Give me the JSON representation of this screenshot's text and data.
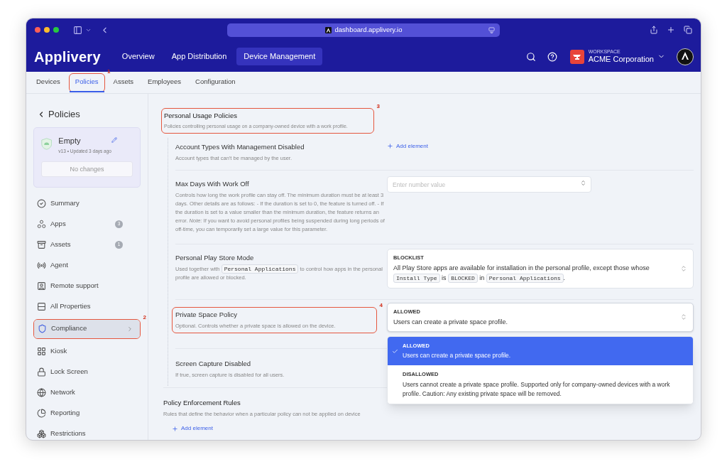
{
  "browser": {
    "url": "dashboard.applivery.io"
  },
  "header": {
    "logo": "Applivery",
    "nav": [
      {
        "label": "Overview",
        "selected": false
      },
      {
        "label": "App Distribution",
        "selected": false
      },
      {
        "label": "Device Management",
        "selected": true
      }
    ],
    "workspace": {
      "caption": "WORKSPACE",
      "name": "ACME Corporation"
    }
  },
  "tabs": [
    {
      "label": "Devices",
      "selected": false
    },
    {
      "label": "Policies",
      "selected": true,
      "callout": "1"
    },
    {
      "label": "Assets",
      "selected": false
    },
    {
      "label": "Employees",
      "selected": false
    },
    {
      "label": "Configuration",
      "selected": false
    }
  ],
  "sidebar": {
    "back_label": "Policies",
    "policy_card": {
      "name": "Empty",
      "meta": "v13 • Updated 3 days ago",
      "button": "No changes"
    },
    "items": [
      {
        "label": "Summary",
        "selected": false
      },
      {
        "label": "Apps",
        "badge": "3",
        "selected": false
      },
      {
        "label": "Assets",
        "badge": "1",
        "selected": false
      },
      {
        "label": "Agent",
        "selected": false
      },
      {
        "label": "Remote support",
        "selected": false
      },
      {
        "label": "All Properties",
        "selected": false
      },
      {
        "label": "Compliance",
        "selected": true,
        "callout": "2"
      },
      {
        "label": "Kiosk",
        "selected": false
      },
      {
        "label": "Lock Screen",
        "selected": false
      },
      {
        "label": "Network",
        "selected": false
      },
      {
        "label": "Reporting",
        "selected": false
      },
      {
        "label": "Restrictions",
        "selected": false
      }
    ]
  },
  "section": {
    "title": "Personal Usage Policies",
    "description": "Policies controlling personal usage on a company-owned device with a work profile.",
    "callout": "3",
    "settings": [
      {
        "kind": "list",
        "title": "Account Types With Management Disabled",
        "description": [
          {
            "kind": "text",
            "text": "Account types that can't be managed by the user."
          }
        ],
        "action": "Add element"
      },
      {
        "kind": "number",
        "title": "Max Days With Work Off",
        "description": [
          {
            "kind": "text",
            "text": "Controls how long the work profile can stay off. The minimum duration must be at least 3 days. Other details are as follows: - If the duration is set to 0, the feature is turned off. - If the duration is set to a value smaller than the minimum duration, the feature returns an error. *Note:* If you want to avoid personal profiles being suspended during long periods of off-time, you can temporarily set a large value for this parameter."
          }
        ],
        "placeholder": "Enter number value"
      },
      {
        "kind": "select",
        "title": "Personal Play Store Mode",
        "description": [
          {
            "kind": "text",
            "text": "Used together with "
          },
          {
            "kind": "code",
            "text": "Personal Applications"
          },
          {
            "kind": "text",
            "text": " to control how apps in the personal profile are allowed or blocked."
          }
        ],
        "value_title": "BLOCKLIST",
        "value_description": [
          {
            "kind": "text",
            "text": "All Play Store apps are available for installation in the personal profile, except those whose "
          },
          {
            "kind": "code",
            "text": "Install Type"
          },
          {
            "kind": "text",
            "text": " is "
          },
          {
            "kind": "code",
            "text": "BLOCKED"
          },
          {
            "kind": "text",
            "text": " in "
          },
          {
            "kind": "code",
            "text": "Personal Applications"
          },
          {
            "kind": "text",
            "text": "."
          }
        ]
      },
      {
        "kind": "select",
        "title": "Private Space Policy",
        "callout": "4",
        "description": [
          {
            "kind": "text",
            "text": "Optional. Controls whether a private space is allowed on the device."
          }
        ],
        "value_title": "ALLOWED",
        "value_description": [
          {
            "kind": "text",
            "text": "Users can create a private space profile."
          }
        ],
        "expanded": true,
        "options": [
          {
            "title": "ALLOWED",
            "description": "Users can create a private space profile.",
            "selected": true
          },
          {
            "title": "DISALLOWED",
            "description": "Users cannot create a private space profile. Supported only for company-owned devices with a work profile. Caution: Any existing private space will be removed.",
            "selected": false
          }
        ]
      },
      {
        "kind": "plain",
        "title": "Screen Capture Disabled",
        "description": [
          {
            "kind": "text",
            "text": "If true, screen capture is disabled for all users."
          }
        ]
      }
    ]
  },
  "enforcement": {
    "title": "Policy Enforcement Rules",
    "description": "Rules that define the behavior when a particular policy can not be applied on device",
    "action": "Add element"
  }
}
